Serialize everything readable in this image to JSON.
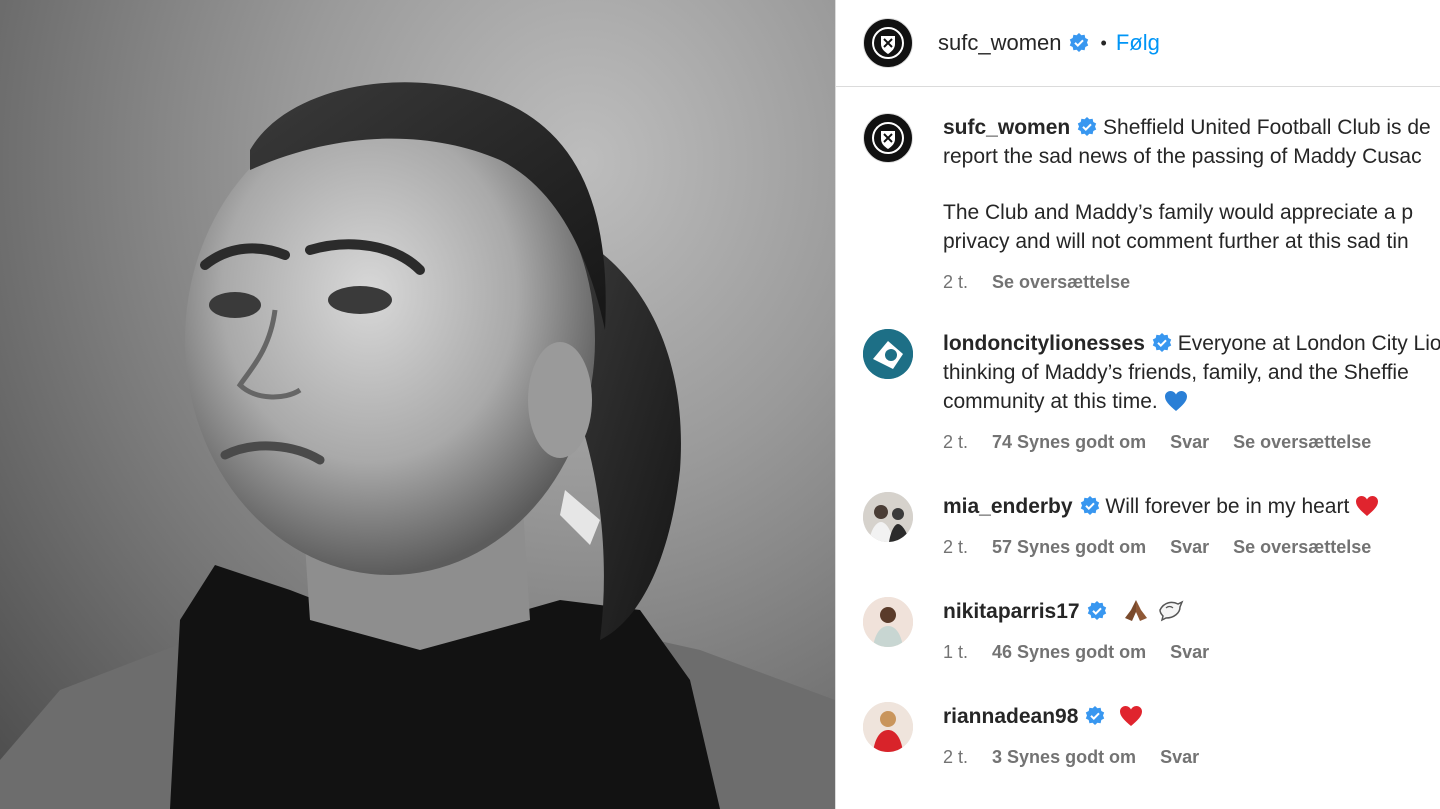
{
  "header": {
    "username": "sufc_women",
    "separator": "•",
    "follow_label": "Følg"
  },
  "caption": {
    "username": "sufc_women",
    "line1": "Sheffield United Football Club is de",
    "line2": "report the sad news of the passing of Maddy Cusac",
    "line3": "The Club and Maddy’s family would appreciate a p",
    "line4": "privacy and will not comment further at this sad tin",
    "time": "2 t.",
    "translate": "Se oversættelse"
  },
  "comments": [
    {
      "username": "londoncitylionesses",
      "lines": [
        "Everyone at London City Lio",
        "thinking of Maddy’s friends, family, and the Sheffie",
        "community at this time."
      ],
      "time": "2 t.",
      "likes": "74 Synes godt om",
      "reply": "Svar",
      "translate": "Se oversættelse"
    },
    {
      "username": "mia_enderby",
      "lines": [
        "Will forever be in my heart"
      ],
      "time": "2 t.",
      "likes": "57 Synes godt om",
      "reply": "Svar",
      "translate": "Se oversættelse"
    },
    {
      "username": "nikitaparris17",
      "lines": [
        ""
      ],
      "time": "1 t.",
      "likes": "46 Synes godt om",
      "reply": "Svar"
    },
    {
      "username": "riannadean98",
      "lines": [
        ""
      ],
      "time": "2 t.",
      "likes": "3 Synes godt om",
      "reply": "Svar"
    }
  ],
  "icons": {
    "verified": "verified-badge-icon",
    "blue_heart": "blue-heart-emoji",
    "red_heart": "red-heart-emoji",
    "praying_hands": "praying-hands-emoji",
    "dove": "dove-emoji"
  },
  "colors": {
    "link_blue": "#0095f6",
    "verified_blue": "#3897f0",
    "meta_gray": "#737373",
    "text": "#262626"
  }
}
